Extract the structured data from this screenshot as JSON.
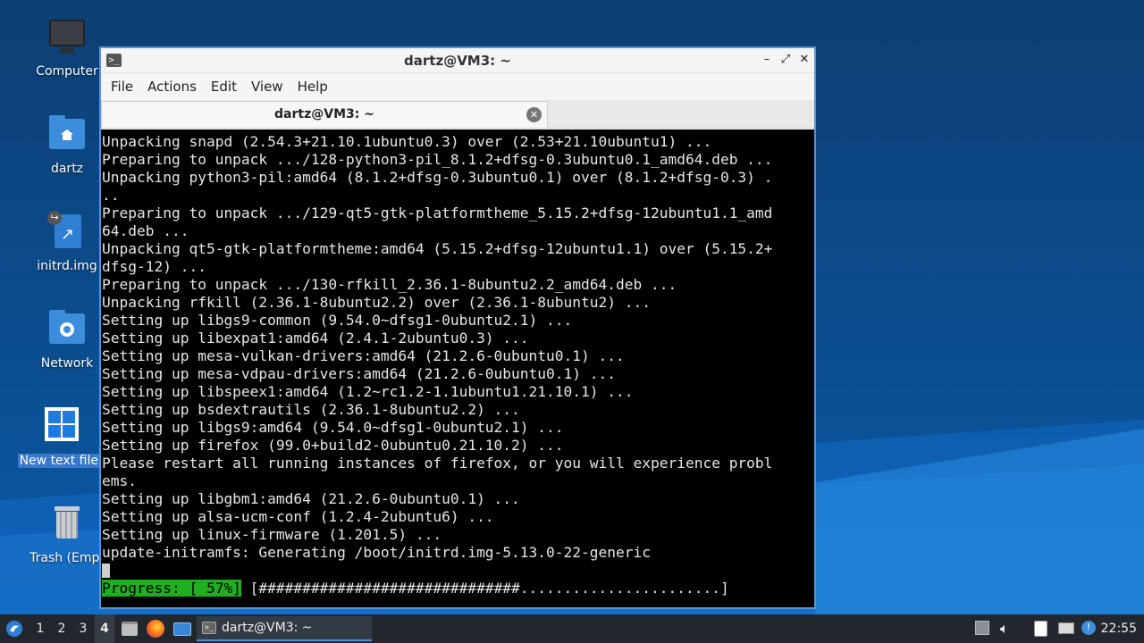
{
  "desktop": {
    "icons": [
      {
        "label": "Computer"
      },
      {
        "label": "dartz"
      },
      {
        "label": "initrd.img"
      },
      {
        "label": "Network"
      },
      {
        "label": "New text file."
      },
      {
        "label": "Trash (Empt"
      }
    ]
  },
  "window": {
    "title": "dartz@VM3: ~",
    "controls": {
      "minimize": "–",
      "maximize": "⤢",
      "close": "✕"
    },
    "menu": [
      "File",
      "Actions",
      "Edit",
      "View",
      "Help"
    ],
    "tab": {
      "label": "dartz@VM3: ~",
      "close": "✕"
    }
  },
  "terminal": {
    "lines": [
      "Unpacking snapd (2.54.3+21.10.1ubuntu0.3) over (2.53+21.10ubuntu1) ...",
      "Preparing to unpack .../128-python3-pil_8.1.2+dfsg-0.3ubuntu0.1_amd64.deb ...",
      "Unpacking python3-pil:amd64 (8.1.2+dfsg-0.3ubuntu0.1) over (8.1.2+dfsg-0.3) .",
      "..",
      "Preparing to unpack .../129-qt5-gtk-platformtheme_5.15.2+dfsg-12ubuntu1.1_amd",
      "64.deb ...",
      "Unpacking qt5-gtk-platformtheme:amd64 (5.15.2+dfsg-12ubuntu1.1) over (5.15.2+",
      "dfsg-12) ...",
      "Preparing to unpack .../130-rfkill_2.36.1-8ubuntu2.2_amd64.deb ...",
      "Unpacking rfkill (2.36.1-8ubuntu2.2) over (2.36.1-8ubuntu2) ...",
      "Setting up libgs9-common (9.54.0~dfsg1-0ubuntu2.1) ...",
      "Setting up libexpat1:amd64 (2.4.1-2ubuntu0.3) ...",
      "Setting up mesa-vulkan-drivers:amd64 (21.2.6-0ubuntu0.1) ...",
      "Setting up mesa-vdpau-drivers:amd64 (21.2.6-0ubuntu0.1) ...",
      "Setting up libspeex1:amd64 (1.2~rc1.2-1.1ubuntu1.21.10.1) ...",
      "Setting up bsdextrautils (2.36.1-8ubuntu2.2) ...",
      "Setting up libgs9:amd64 (9.54.0~dfsg1-0ubuntu2.1) ...",
      "Setting up firefox (99.0+build2-0ubuntu0.21.10.2) ...",
      "Please restart all running instances of firefox, or you will experience probl",
      "ems.",
      "Setting up libgbm1:amd64 (21.2.6-0ubuntu0.1) ...",
      "Setting up alsa-ucm-conf (1.2.4-2ubuntu6) ...",
      "Setting up linux-firmware (1.201.5) ...",
      "update-initramfs: Generating /boot/initrd.img-5.13.0-22-generic"
    ],
    "progress": {
      "label": "Progress: [ 57%]",
      "bar": " [##############################.......................]",
      "fraction": 0.57
    }
  },
  "taskbar": {
    "workspaces": [
      "1",
      "2",
      "3",
      "4"
    ],
    "active_workspace": "4",
    "task_label": "dartz@VM3: ~",
    "clock": "22:55"
  },
  "colors": {
    "wallpaper": "#0b4a86",
    "window_border": "#5a95d3",
    "progress_green": "#1fae1f",
    "taskbar": "#22272e"
  },
  "icons": [
    "start-menu-icon",
    "file-manager-icon",
    "firefox-icon",
    "desktop-icon",
    "terminal-icon",
    "volume-icon",
    "clipboard-icon",
    "network-icon",
    "updates-icon"
  ]
}
